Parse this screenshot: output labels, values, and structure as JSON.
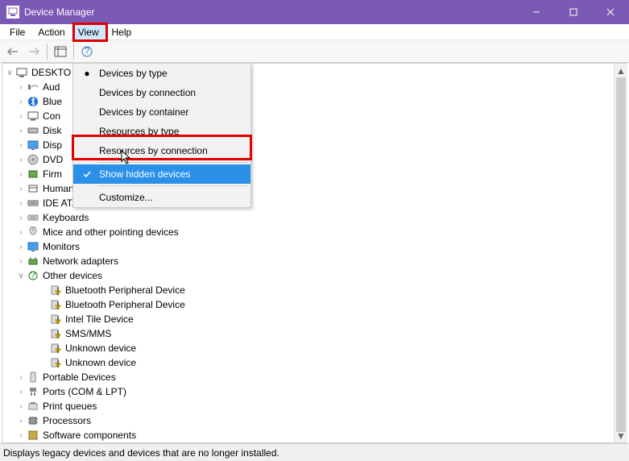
{
  "window": {
    "title": "Device Manager"
  },
  "menubar": {
    "file": "File",
    "action": "Action",
    "view": "View",
    "help": "Help"
  },
  "view_menu": {
    "devices_by_type": "Devices by type",
    "devices_by_connection": "Devices by connection",
    "devices_by_container": "Devices by container",
    "resources_by_type": "Resources by type",
    "resources_by_connection": "Resources by connection",
    "show_hidden": "Show hidden devices",
    "customize": "Customize..."
  },
  "tree": {
    "root": "DESKTO",
    "items": [
      "Aud",
      "Blue",
      "Con",
      "Disk",
      "Disp",
      "DVD",
      "Firm",
      "Human Interface Devices",
      "IDE ATA/ATAPI controllers",
      "Keyboards",
      "Mice and other pointing devices",
      "Monitors",
      "Network adapters",
      "Other devices",
      "Portable Devices",
      "Ports (COM & LPT)",
      "Print queues",
      "Processors",
      "Software components"
    ],
    "other_children": [
      "Bluetooth Peripheral Device",
      "Bluetooth Peripheral Device",
      "Intel Tile Device",
      "SMS/MMS",
      "Unknown device",
      "Unknown device"
    ]
  },
  "statusbar": {
    "text": "Displays legacy devices and devices that are no longer installed."
  }
}
